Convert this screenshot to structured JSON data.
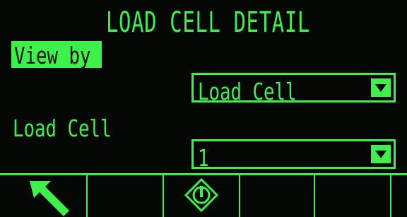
{
  "screen": {
    "title": "LOAD CELL DETAIL",
    "view_by": {
      "label": "View by",
      "selected": "Load Cell"
    },
    "load_cell": {
      "label": "Load Cell",
      "selected": "1"
    }
  },
  "softkeys": [
    {
      "icon": "back-arrow-icon"
    },
    {
      "icon": ""
    },
    {
      "icon": "start-icon"
    },
    {
      "icon": ""
    },
    {
      "icon": ""
    }
  ],
  "colors": {
    "foreground": "#3df04a",
    "background": "#050805"
  }
}
